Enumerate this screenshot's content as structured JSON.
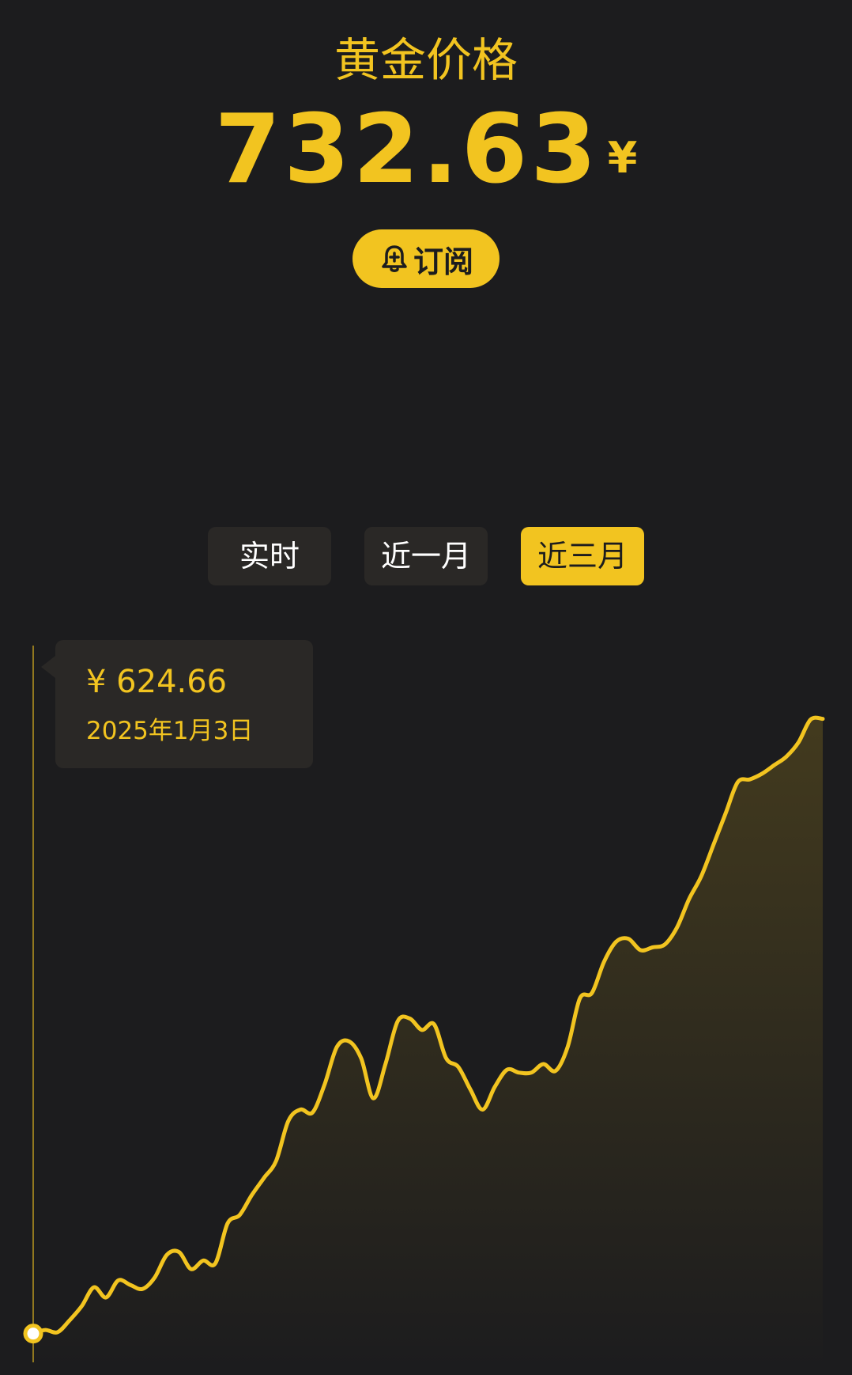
{
  "header": {
    "title": "黄金价格",
    "price": "732.63",
    "currency": "¥",
    "subscribe_label": "订阅"
  },
  "tabs": [
    {
      "label": "实时",
      "active": false
    },
    {
      "label": "近一月",
      "active": false
    },
    {
      "label": "近三月",
      "active": true
    }
  ],
  "tooltip": {
    "price": "¥ 624.66",
    "date": "2025年1月3日"
  },
  "colors": {
    "accent": "#f2c420",
    "background": "#1c1c1e",
    "panel": "#2a2826"
  },
  "icons": {
    "subscribe": "bell-plus-icon"
  },
  "chart_data": {
    "type": "area",
    "title": "",
    "xlabel": "",
    "ylabel": "",
    "grid": false,
    "x": [
      "2025-01-03",
      "d2",
      "d3",
      "d4",
      "d5",
      "d6",
      "d7",
      "d8",
      "d9",
      "d10",
      "d11",
      "d12",
      "d13",
      "d14",
      "d15",
      "d16",
      "d17",
      "d18",
      "d19",
      "d20",
      "d21",
      "d22",
      "d23",
      "d24",
      "d25",
      "d26",
      "d27",
      "d28",
      "d29",
      "d30",
      "d31",
      "d32",
      "d33",
      "d34",
      "d35",
      "d36",
      "d37",
      "d38",
      "d39",
      "d40",
      "d41",
      "d42",
      "d43",
      "d44",
      "d45",
      "d46",
      "d47",
      "d48",
      "d49",
      "d50",
      "d51",
      "d52",
      "d53",
      "d54",
      "d55",
      "d56",
      "d57",
      "d58",
      "d59",
      "d60",
      "d61",
      "d62",
      "d63",
      "d64",
      "d65",
      "d66"
    ],
    "values": [
      624.66,
      625.3,
      624.9,
      627.0,
      629.5,
      632.8,
      631.0,
      634.0,
      633.2,
      632.5,
      634.5,
      638.5,
      639.0,
      636.0,
      637.5,
      637.0,
      644.0,
      645.5,
      649.0,
      652.0,
      655.0,
      662.0,
      664.0,
      663.5,
      668.5,
      675.0,
      676.0,
      673.0,
      666.0,
      672.0,
      679.5,
      680.0,
      678.0,
      679.0,
      673.0,
      671.5,
      667.5,
      664.0,
      668.0,
      671.0,
      670.5,
      670.5,
      672.0,
      670.8,
      675.0,
      683.5,
      684.5,
      690.0,
      693.5,
      694.0,
      692.0,
      692.5,
      693.0,
      696.0,
      701.0,
      705.0,
      710.5,
      716.0,
      721.5,
      722.0,
      723.0,
      724.5,
      726.0,
      728.5,
      732.5,
      732.63
    ],
    "ylim": [
      621,
      738
    ]
  }
}
